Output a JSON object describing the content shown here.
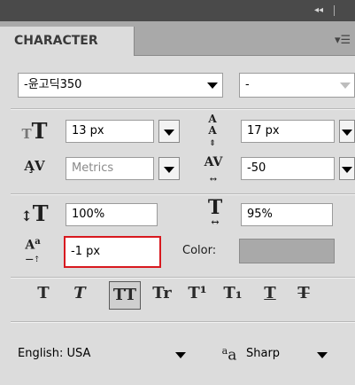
{
  "panel": {
    "tab_title": "CHARACTER",
    "collapse_icon": "double-left-arrow-icon",
    "menu_icon": "panel-menu-icon"
  },
  "font": {
    "family": "-윤고딕350",
    "style": "-"
  },
  "size": {
    "icon": "font-size-icon",
    "value": "13 px"
  },
  "leading": {
    "icon": "leading-icon",
    "value": "17 px"
  },
  "kerning": {
    "icon": "kerning-icon",
    "value": "Metrics"
  },
  "tracking": {
    "icon": "tracking-icon",
    "value": "-50"
  },
  "vertical_scale": {
    "icon": "vertical-scale-icon",
    "value": "100%"
  },
  "horizontal_scale": {
    "icon": "horizontal-scale-icon",
    "value": "95%"
  },
  "baseline_shift": {
    "icon": "baseline-shift-icon",
    "value": "-1 px"
  },
  "color": {
    "label": "Color:",
    "swatch": "#a9a9a9"
  },
  "styles": [
    {
      "name": "faux-bold",
      "glyph": "T"
    },
    {
      "name": "faux-italic",
      "glyph": "T"
    },
    {
      "name": "all-caps",
      "glyph": "TT"
    },
    {
      "name": "small-caps",
      "glyph": "Tr"
    },
    {
      "name": "superscript",
      "glyph": "T¹"
    },
    {
      "name": "subscript",
      "glyph": "T₁"
    },
    {
      "name": "underline",
      "glyph": "T"
    },
    {
      "name": "strikethrough",
      "glyph": "T"
    }
  ],
  "language": {
    "value": "English: USA"
  },
  "antialias": {
    "icon_text": "ªa",
    "value": "Sharp"
  },
  "colors": {
    "highlight": "#d8191f",
    "panel_bg": "#dcdcdc",
    "tab_bar": "#a9a9a9",
    "top_bar": "#4a4a4a"
  }
}
